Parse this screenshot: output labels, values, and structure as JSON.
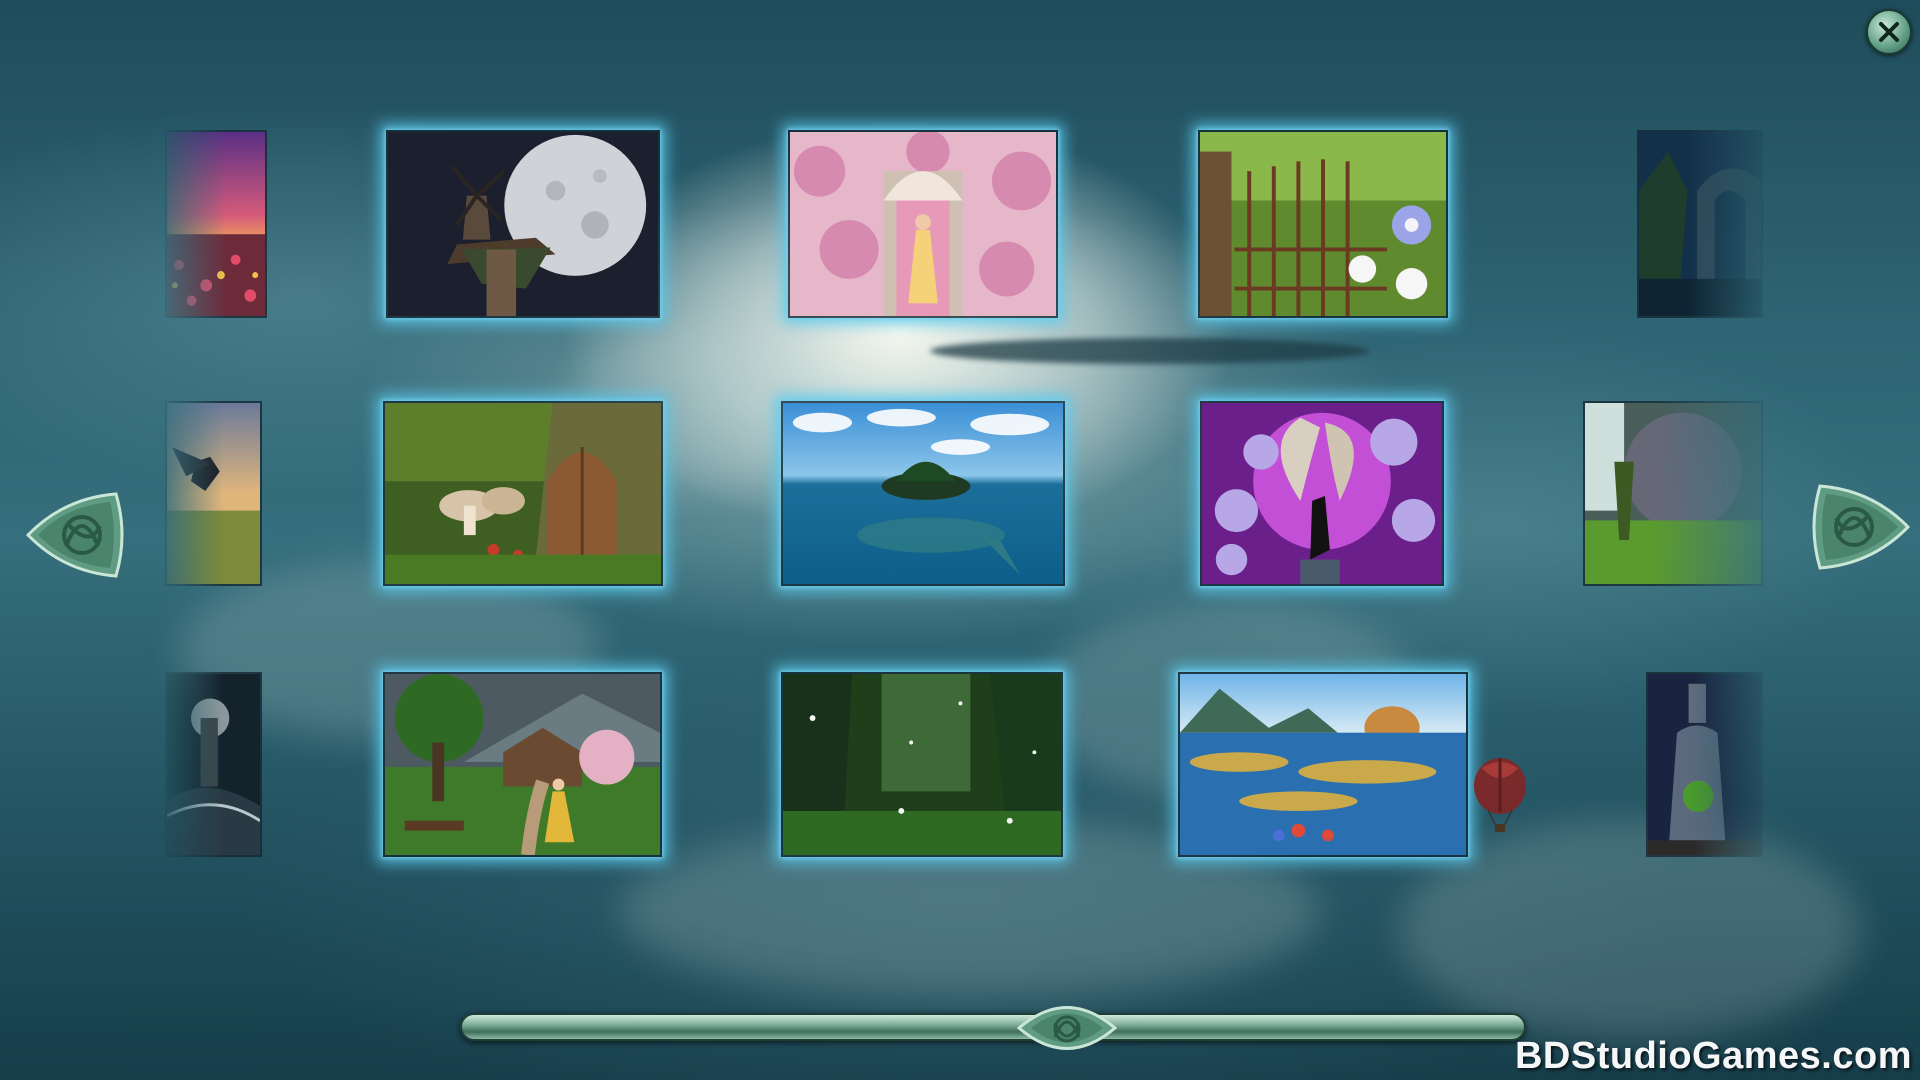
{
  "close_button": {
    "icon": "close-icon"
  },
  "nav": {
    "prev_icon": "celtic-knot-left-arrow-icon",
    "next_icon": "celtic-knot-right-arrow-icon"
  },
  "slider": {
    "position": 0.57,
    "handle_icon": "celtic-knot-icon"
  },
  "puzzles": [
    {
      "id": "aurora-flower-field"
    },
    {
      "id": "moon-windmill"
    },
    {
      "id": "blossom-arch-lady"
    },
    {
      "id": "garden-gate-morning-glory"
    },
    {
      "id": "moonlit-stone-arch"
    },
    {
      "id": "raven-meadow-sunset"
    },
    {
      "id": "fairy-door-mushrooms"
    },
    {
      "id": "turtle-island"
    },
    {
      "id": "butterfly-fairy-alliums"
    },
    {
      "id": "misty-forest-waterfall"
    },
    {
      "id": "stormy-lighthouse"
    },
    {
      "id": "cottage-path-maiden"
    },
    {
      "id": "enchanted-forest-fairies"
    },
    {
      "id": "coral-reef-coast"
    },
    {
      "id": "bottle-terrarium"
    }
  ],
  "decorations": {
    "balloon_icon": "hot-air-balloon-icon"
  },
  "watermark": "BDStudioGames.com",
  "colors": {
    "accent_glow": "#5ac8eb",
    "ui_green": "#5f9c83"
  }
}
